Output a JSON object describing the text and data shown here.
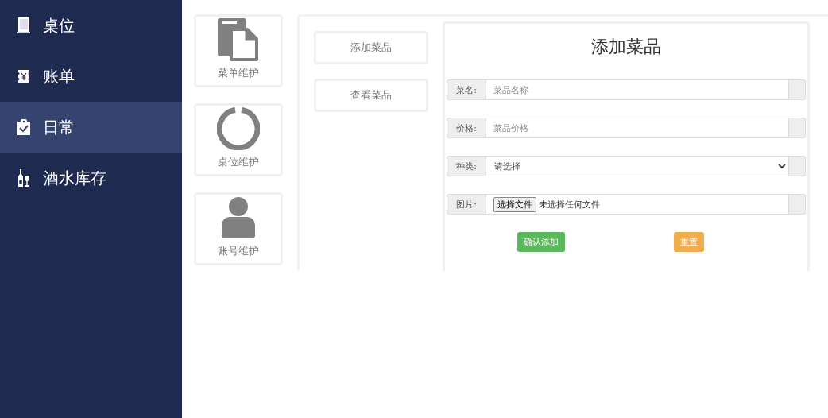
{
  "sidebar": {
    "items": [
      {
        "label": "桌位",
        "kind": "tablet",
        "selected": false
      },
      {
        "label": "账单",
        "kind": "receipt",
        "selected": false
      },
      {
        "label": "日常",
        "kind": "clipboard",
        "selected": true
      },
      {
        "label": "酒水库存",
        "kind": "drinks",
        "selected": false
      }
    ]
  },
  "tiles": [
    {
      "label": "菜单维护",
      "kind": "files"
    },
    {
      "label": "桌位维护",
      "kind": "ring"
    },
    {
      "label": "账号维护",
      "kind": "user"
    }
  ],
  "submenu": [
    {
      "label": "添加菜品"
    },
    {
      "label": "查看菜品"
    }
  ],
  "form": {
    "title": "添加菜品",
    "fields": [
      {
        "kind": "text",
        "label": "菜名:",
        "placeholder": "菜品名称"
      },
      {
        "kind": "text",
        "label": "价格:",
        "placeholder": "菜品价格"
      },
      {
        "kind": "select",
        "label": "种类:",
        "value": "请选择"
      },
      {
        "kind": "file",
        "label": "图片:",
        "button": "选择文件",
        "value": "未选择任何文件"
      }
    ],
    "buttons": [
      {
        "kind": "confirm",
        "label": "确认添加"
      },
      {
        "kind": "reset",
        "label": "重置"
      }
    ]
  }
}
